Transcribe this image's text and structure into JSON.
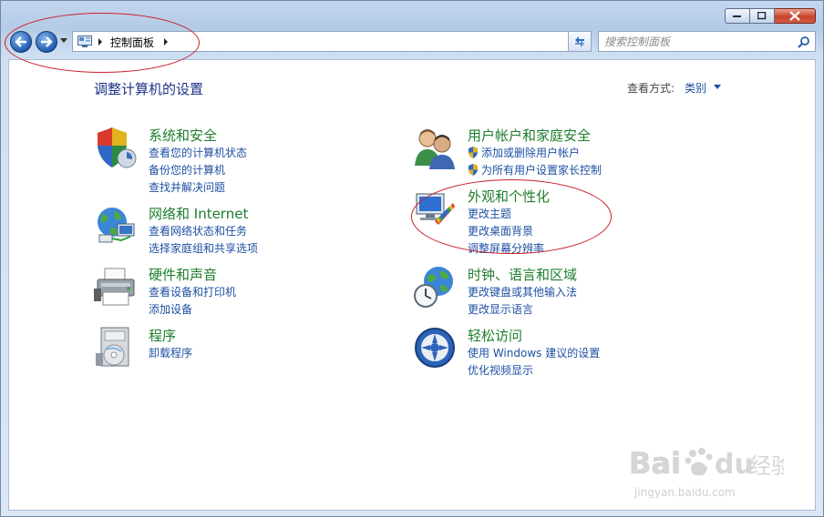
{
  "window": {
    "caption": {
      "minimize": "minimize",
      "maximize": "maximize",
      "close": "close"
    }
  },
  "address": {
    "path": "控制面板"
  },
  "search": {
    "placeholder": "搜索控制面板"
  },
  "header": {
    "title": "调整计算机的设置",
    "view_by_label": "查看方式:",
    "view_by_value": "类别"
  },
  "categories": [
    {
      "title": "系统和安全",
      "icon": "shield-icon",
      "links": [
        "查看您的计算机状态",
        "备份您的计算机",
        "查找并解决问题"
      ]
    },
    {
      "title": "网络和 Internet",
      "icon": "network-icon",
      "links": [
        "查看网络状态和任务",
        "选择家庭组和共享选项"
      ]
    },
    {
      "title": "硬件和声音",
      "icon": "printer-icon",
      "links": [
        "查看设备和打印机",
        "添加设备"
      ]
    },
    {
      "title": "程序",
      "icon": "programs-icon",
      "links": [
        "卸载程序"
      ]
    },
    {
      "title": "用户帐户和家庭安全",
      "icon": "users-icon",
      "links": [
        "添加或删除用户帐户",
        "为所有用户设置家长控制"
      ]
    },
    {
      "title": "外观和个性化",
      "icon": "appearance-icon",
      "links": [
        "更改主题",
        "更改桌面背景",
        "调整屏幕分辨率"
      ]
    },
    {
      "title": "时钟、语言和区域",
      "icon": "clock-globe-icon",
      "links": [
        "更改键盘或其他输入法",
        "更改显示语言"
      ]
    },
    {
      "title": "轻松访问",
      "icon": "ease-of-access-icon",
      "links": [
        "使用 Windows 建议的设置",
        "优化视频显示"
      ]
    }
  ],
  "watermark": {
    "brand": "Baidu经验",
    "url": "jingyan.baidu.com"
  },
  "colors": {
    "title_blue": "#1e3287",
    "category_green": "#1d7d2c",
    "link_blue": "#1e50a2",
    "annotation_red": "#cc1f2b"
  }
}
